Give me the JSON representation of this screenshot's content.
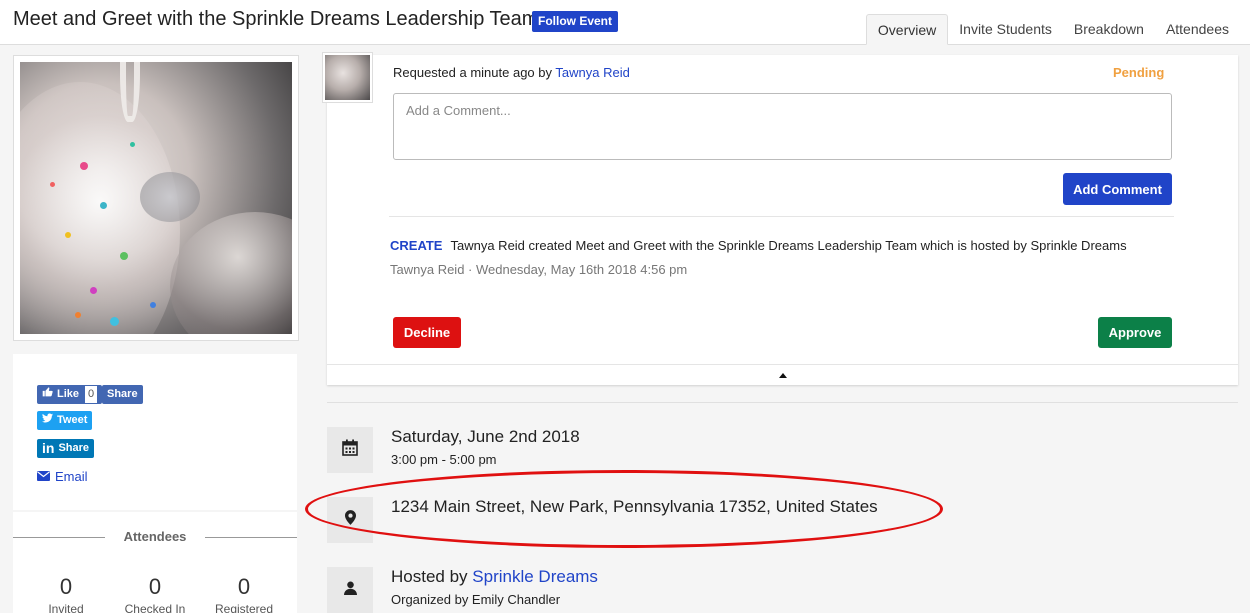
{
  "header": {
    "title": "Meet and Greet with the Sprinkle Dreams Leadership Team",
    "follow_label": "Follow Event",
    "tabs": [
      {
        "label": "Overview",
        "active": true
      },
      {
        "label": "Invite Students",
        "active": false
      },
      {
        "label": "Breakdown",
        "active": false
      },
      {
        "label": "Attendees",
        "active": false
      }
    ]
  },
  "share": {
    "fb_like_label": "Like",
    "fb_like_count": "0",
    "fb_share_label": "Share",
    "tweet_label": "Tweet",
    "linkedin_label": "Share",
    "email_label": "Email"
  },
  "attendees": {
    "heading": "Attendees",
    "stats": [
      {
        "value": "0",
        "label": "Invited"
      },
      {
        "value": "0",
        "label": "Checked In"
      },
      {
        "value": "0",
        "label": "Registered"
      }
    ]
  },
  "request": {
    "requested_prefix": "Requested a minute ago by",
    "requested_by": "Tawnya Reid",
    "status": "Pending",
    "comment_placeholder": "Add a Comment...",
    "add_comment_label": "Add Comment",
    "activity_type": "CREATE",
    "activity_text": "Tawnya Reid created Meet and Greet with the Sprinkle Dreams Leadership Team which is hosted by Sprinkle Dreams",
    "activity_meta": "Tawnya Reid · Wednesday, May 16th 2018 4:56 pm",
    "decline_label": "Decline",
    "approve_label": "Approve"
  },
  "details": {
    "date": "Saturday, June 2nd 2018",
    "time": "3:00 pm - 5:00 pm",
    "address": "1234 Main Street, New Park, Pennsylvania 17352, United States",
    "hosted_prefix": "Hosted by",
    "host": "Sprinkle Dreams",
    "organized": "Organized by Emily Chandler"
  },
  "colors": {
    "accent": "#2044c8",
    "pending": "#f0a040",
    "decline": "#dd1111",
    "approve": "#0c8048",
    "annotation": "#e01010"
  }
}
